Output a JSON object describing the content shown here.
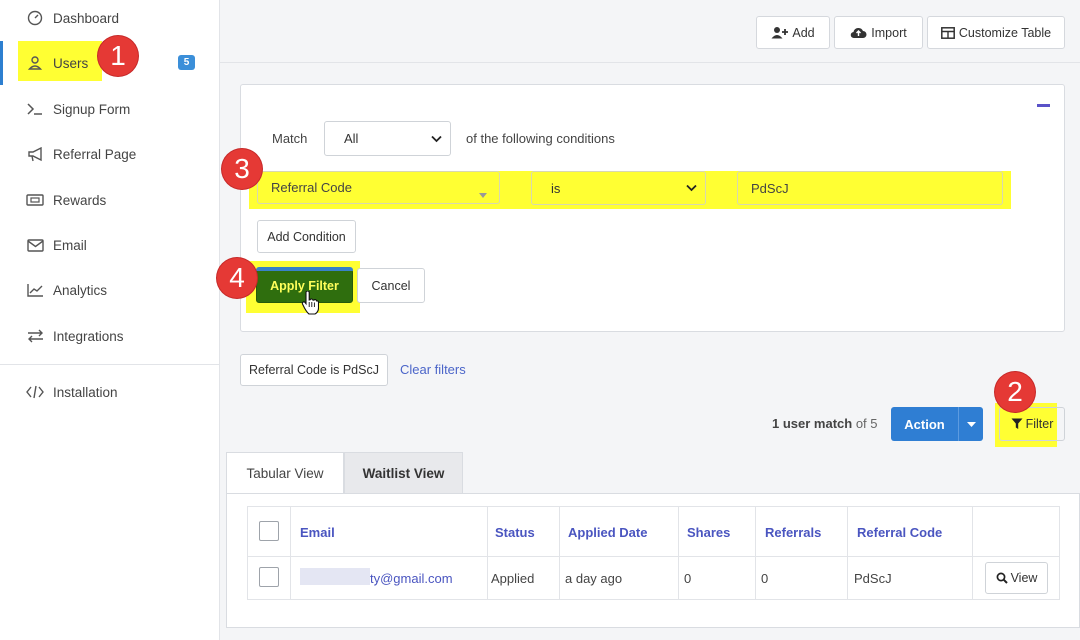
{
  "sidebar": {
    "items": [
      {
        "label": "Dashboard",
        "icon": "dashboard-gauge-icon"
      },
      {
        "label": "Users",
        "icon": "user-icon",
        "badge": "5",
        "active": true
      },
      {
        "label": "Signup Form",
        "icon": "terminal-prompt-icon"
      },
      {
        "label": "Referral Page",
        "icon": "megaphone-icon"
      },
      {
        "label": "Rewards",
        "icon": "ticket-icon"
      },
      {
        "label": "Email",
        "icon": "envelope-icon"
      },
      {
        "label": "Analytics",
        "icon": "line-chart-icon"
      },
      {
        "label": "Integrations",
        "icon": "exchange-arrows-icon"
      },
      {
        "label": "Installation",
        "icon": "code-icon"
      }
    ]
  },
  "toolbar": {
    "add_label": "Add",
    "import_label": "Import",
    "customize_label": "Customize Table"
  },
  "filter_panel": {
    "match_label": "Match",
    "match_value": "All",
    "conditions_text": "of the following conditions",
    "field": "Referral Code",
    "operator": "is",
    "value": "PdScJ",
    "add_condition_label": "Add Condition",
    "apply_label": "Apply Filter",
    "cancel_label": "Cancel"
  },
  "active_filters": {
    "chip_label": "Referral Code is PdScJ",
    "clear_label": "Clear filters"
  },
  "results": {
    "count_bold": "1 user match",
    "count_rest": " of 5",
    "action_label": "Action",
    "filter_label": "Filter"
  },
  "tabs": [
    {
      "label": "Tabular View",
      "active": true
    },
    {
      "label": "Waitlist View",
      "active": false
    }
  ],
  "table": {
    "columns": [
      "Email",
      "Status",
      "Applied Date",
      "Shares",
      "Referrals",
      "Referral Code"
    ],
    "rows": [
      {
        "email": "ty@gmail.com",
        "status": "Applied",
        "applied_date": "a day ago",
        "shares": "0",
        "referrals": "0",
        "referral_code": "PdScJ",
        "view_label": "View"
      }
    ]
  },
  "markers": [
    "1",
    "2",
    "3",
    "4"
  ],
  "colors": {
    "highlight": "#ffff33",
    "primary": "#2f7ed3",
    "apply_green": "#2f6e0e",
    "marker_red": "#e53935",
    "link": "#4a55c0"
  }
}
